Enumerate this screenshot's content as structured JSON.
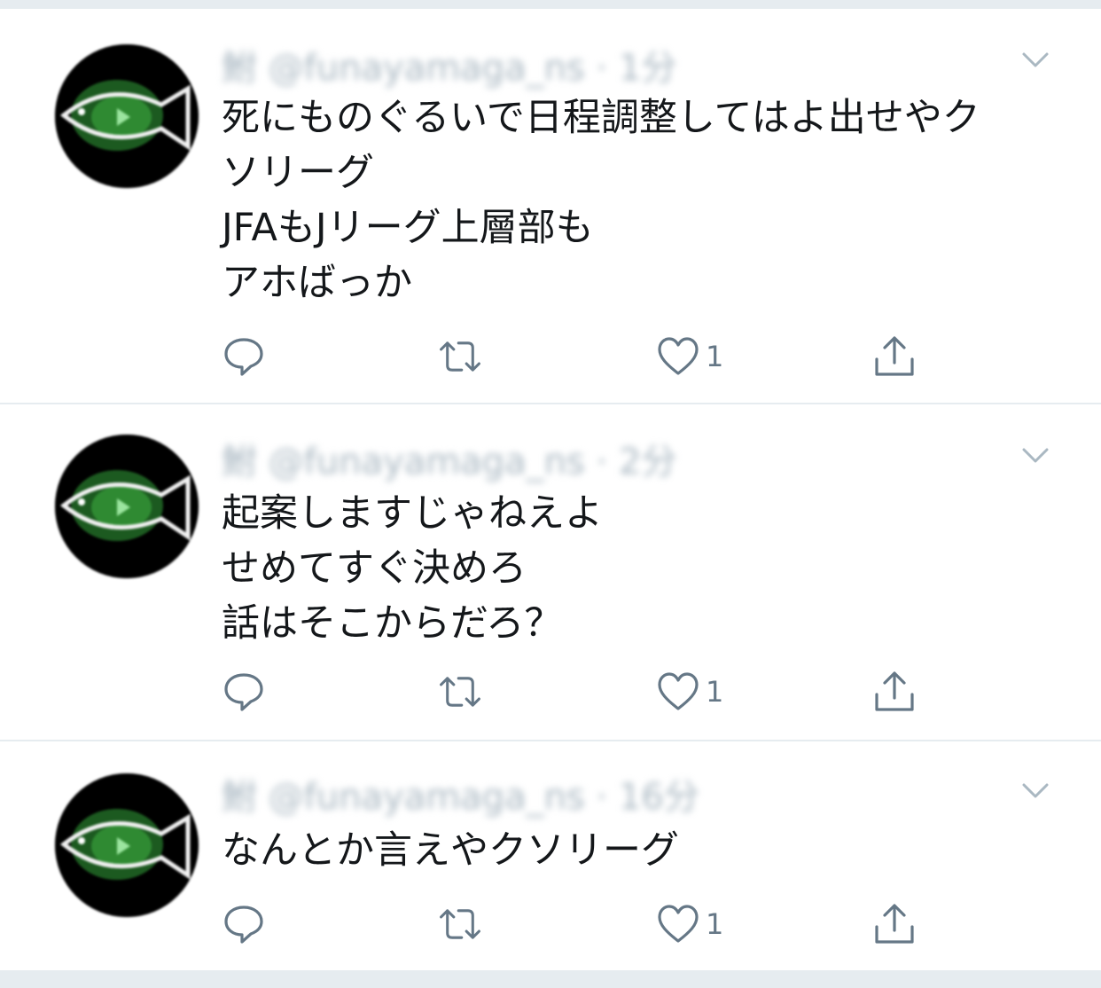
{
  "tweets": [
    {
      "display_name": "鮒",
      "handle": "@funayamaga_ns",
      "separator": "·",
      "time": "1分",
      "lines": [
        "死にものぐるいで日程調整してはよ出せやク",
        "ソリーグ",
        "JFAもJリーグ上層部も",
        "アホばっか"
      ],
      "like_count": "1"
    },
    {
      "display_name": "鮒",
      "handle": "@funayamaga_ns",
      "separator": "·",
      "time": "2分",
      "lines": [
        "起案しますじゃねえよ",
        "せめてすぐ決めろ",
        "話はそこからだろ？"
      ],
      "like_count": "1"
    },
    {
      "display_name": "鮒",
      "handle": "@funayamaga_ns",
      "separator": "·",
      "time": "16分",
      "lines": [
        "なんとか言えやクソリーグ"
      ],
      "like_count": "1"
    }
  ],
  "icons": {
    "reply": "reply-icon",
    "retweet": "retweet-icon",
    "like": "heart-icon",
    "share": "share-icon",
    "caret": "chevron-down-icon"
  },
  "colors": {
    "icon": "#657786",
    "text": "#14171a",
    "meta": "#aab8c2",
    "background": "#e6ecf0",
    "card": "#ffffff"
  }
}
